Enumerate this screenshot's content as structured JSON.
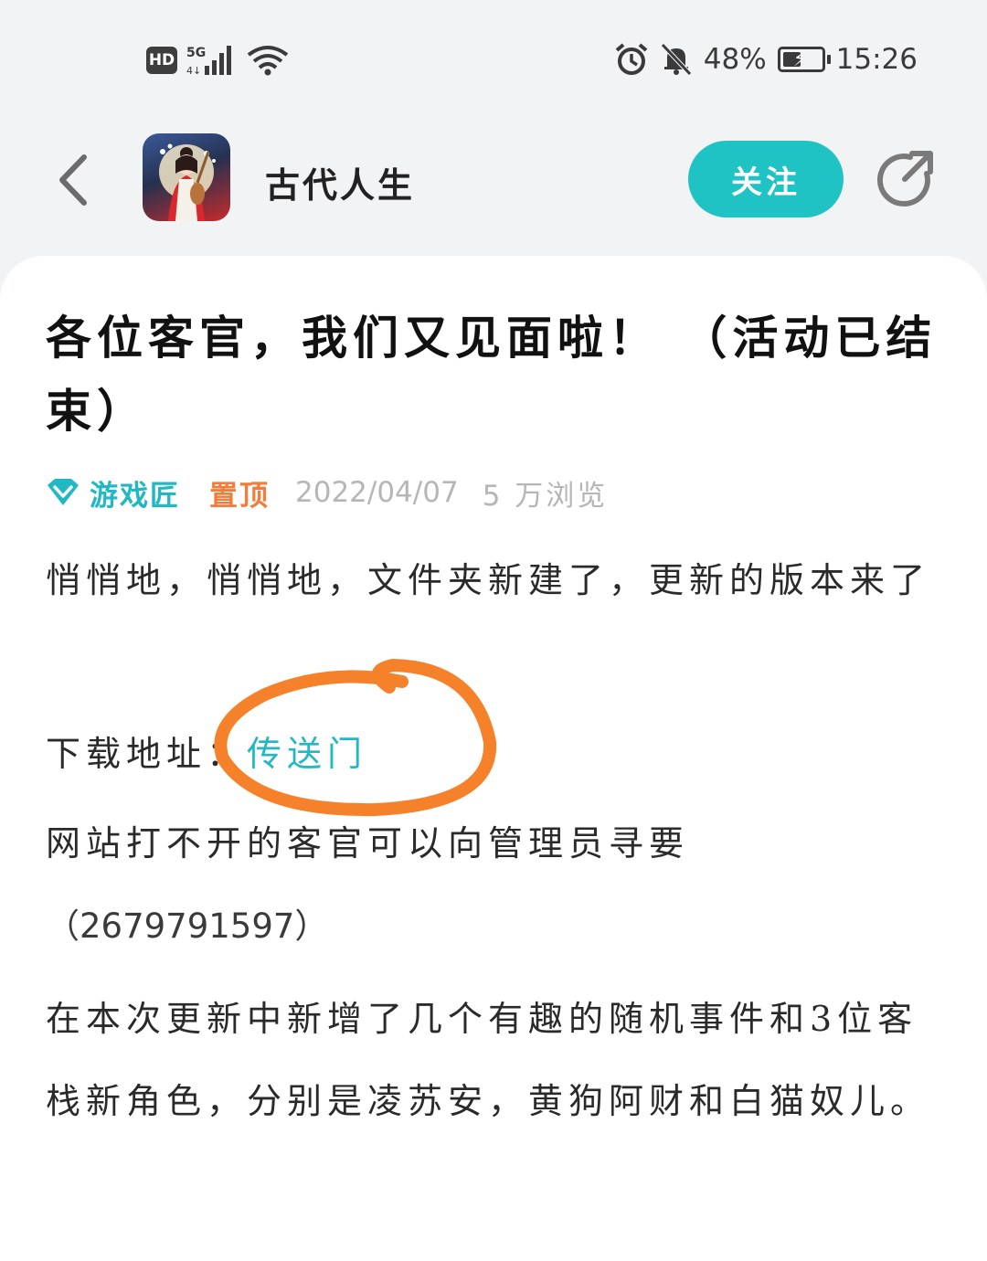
{
  "status_bar": {
    "hd": "HD",
    "network": "5G",
    "battery_percent": "48%",
    "battery_level": 0.48,
    "time": "15:26"
  },
  "header": {
    "app_name": "古代人生",
    "follow_label": "关注"
  },
  "post": {
    "title": "各位客官，我们又见面啦！ （活动已结束）",
    "author": "游戏匠",
    "pinned_label": "置顶",
    "date": "2022/04/07",
    "views": "5 万浏览",
    "paragraph1": "悄悄地，悄悄地，文件夹新建了，更新的版本来了",
    "download_label": "下载地址：",
    "download_link": "传送门",
    "paragraph3": "网站打不开的客官可以向管理员寻要",
    "qq": "（2679791597）",
    "paragraph5": "在本次更新中新增了几个有趣的随机事件和3位客栈新角色，分别是凌苏安，黄狗阿财和白猫奴儿。"
  },
  "colors": {
    "accent": "#1fc3c3",
    "link": "#21b8c4",
    "pinned": "#f07d3b",
    "annotation": "#f5822a"
  }
}
